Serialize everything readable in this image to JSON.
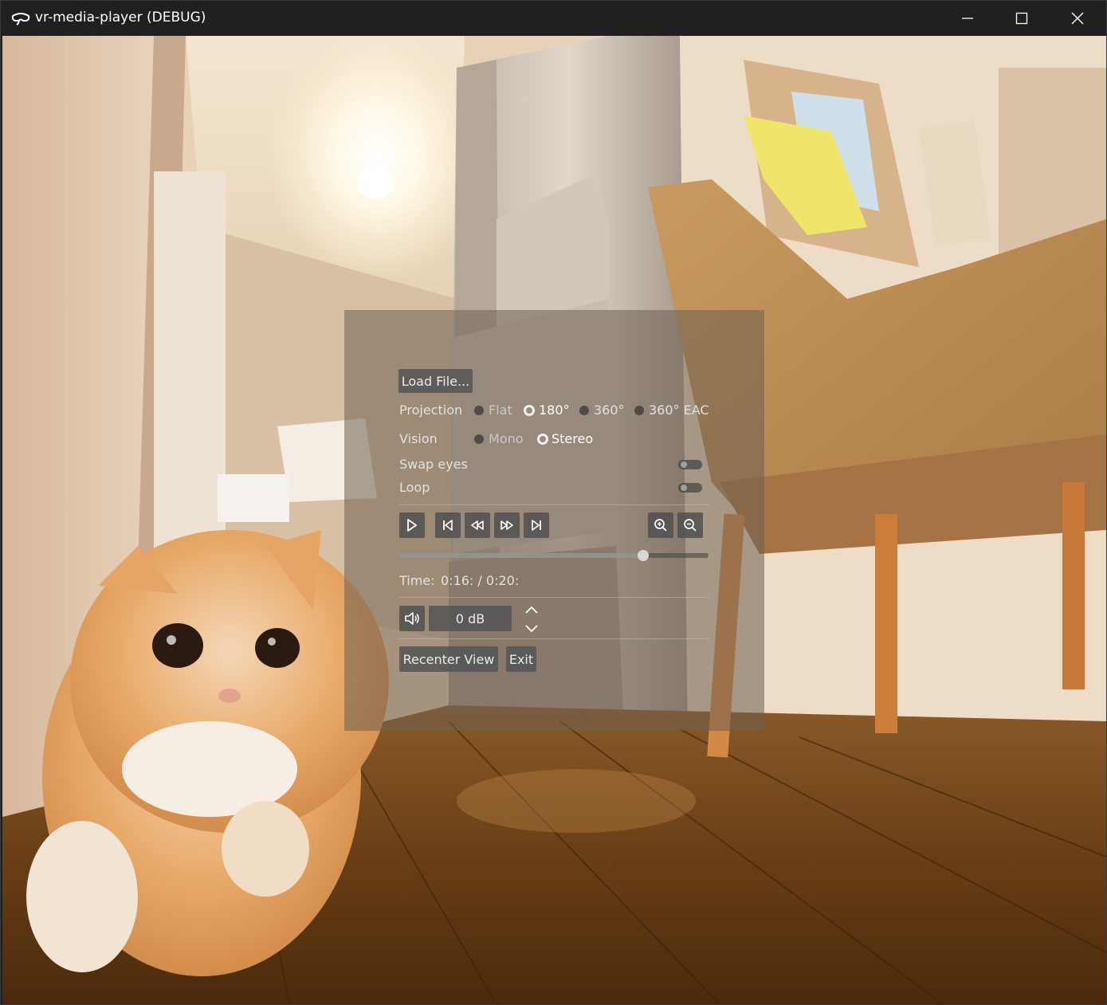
{
  "window": {
    "title": "vr-media-player (DEBUG)"
  },
  "icons": {
    "app": "vr-headset-icon",
    "minimize": "minimize-icon",
    "maximize": "maximize-icon",
    "close": "close-icon"
  },
  "player": {
    "load_file_label": "Load File...",
    "projection": {
      "label": "Projection",
      "options": [
        "Flat",
        "180°",
        "360°",
        "360° EAC"
      ],
      "selected": "180°"
    },
    "vision": {
      "label": "Vision",
      "options": [
        "Mono",
        "Stereo"
      ],
      "selected": "Stereo"
    },
    "swap_eyes": {
      "label": "Swap eyes",
      "on": false
    },
    "loop": {
      "label": "Loop",
      "on": false
    },
    "seek_progress": 0.8,
    "time": {
      "label": "Time:",
      "value": "0:16: / 0:20:"
    },
    "volume": {
      "value": "0 dB"
    },
    "recenter_label": "Recenter View",
    "exit_label": "Exit"
  }
}
